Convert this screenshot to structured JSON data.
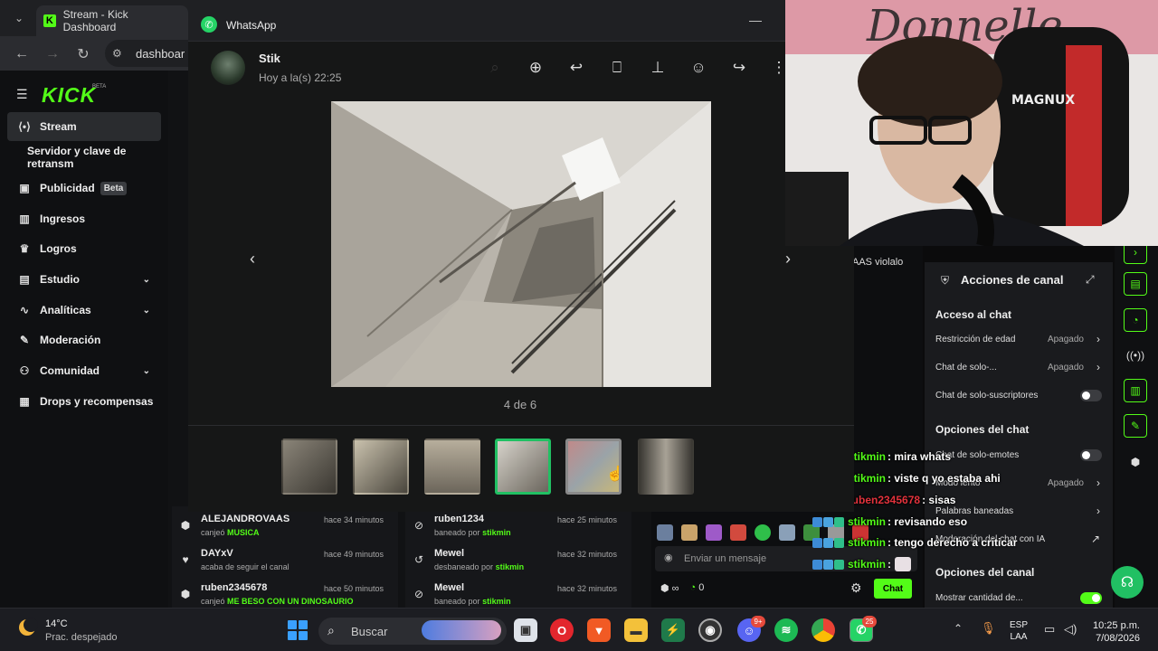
{
  "browser": {
    "tab_title": "Stream - Kick Dashboard",
    "address": "dashboar"
  },
  "kick": {
    "logo": "KICK",
    "logo_beta": "BETA",
    "sidebar": [
      {
        "label": "Stream",
        "icon": "broadcast-icon"
      },
      {
        "label": "Servidor y clave de retransm",
        "icon": ""
      },
      {
        "label": "Publicidad",
        "badge": "Beta",
        "icon": "ad-icon"
      },
      {
        "label": "Ingresos",
        "icon": "revenue-icon"
      },
      {
        "label": "Logros",
        "icon": "trophy-icon"
      },
      {
        "label": "Estudio",
        "icon": "studio-icon"
      },
      {
        "label": "Analíticas",
        "icon": "analytics-icon"
      },
      {
        "label": "Moderación",
        "icon": "wrench-icon"
      },
      {
        "label": "Comunidad",
        "icon": "community-icon"
      },
      {
        "label": "Drops y recompensas",
        "icon": "gift-icon"
      }
    ],
    "feed_left": [
      {
        "name": "ALEJANDROVAAS",
        "action": "canjeó",
        "target": "MUSICA",
        "when": "hace 34 minutos"
      },
      {
        "name": "DAYxV",
        "action": "acaba de seguir el canal",
        "target": "",
        "when": "hace 49 minutos"
      },
      {
        "name": "ruben2345678",
        "action": "canjeó",
        "target": "ME BESO CON UN DINOSAURIO",
        "when": "hace 50 minutos"
      }
    ],
    "feed_right": [
      {
        "name": "ruben1234",
        "action": "baneado por",
        "target": "stikmin",
        "when": "hace 25 minutos"
      },
      {
        "name": "Mewel",
        "action": "desbaneado por",
        "target": "stikmin",
        "when": "hace 32 minutos"
      },
      {
        "name": "Mewel",
        "action": "baneado por",
        "target": "stikmin",
        "when": "hace 32 minutos"
      }
    ],
    "chat": {
      "snippet": "AAS violalo",
      "placeholder": "Enviar un mensaje",
      "points": "0",
      "send_label": "Chat"
    },
    "actions": {
      "title": "Acciones de canal",
      "section_access": "Acceso al chat",
      "age_label": "Restricción de edad",
      "age_value": "Apagado",
      "followers_label": "Chat de solo-...",
      "followers_value": "Apagado",
      "subs_label": "Chat de solo-suscriptores",
      "section_chat": "Opciones del chat",
      "emotes_label": "Chat de solo-emotes",
      "slow_label": "Modo lento",
      "slow_value": "Apagado",
      "banned_words": "Palabras baneadas",
      "ai_mod": "Moderación del chat con IA",
      "section_channel": "Opciones del canal",
      "show_count": "Mostrar cantidad de..."
    }
  },
  "whatsapp": {
    "app_title": "WhatsApp",
    "contact": "Stik",
    "timestamp": "Hoy a la(s) 22:25",
    "counter": "4 de 6",
    "thumbnails": 6,
    "active_thumbnail": 4
  },
  "overlay_chat": [
    {
      "user": "stikmin",
      "color": "#53fc18",
      "text": ": mira whats"
    },
    {
      "user": "stikmin",
      "color": "#53fc18",
      "text": ": viste q yo estaba ahi"
    },
    {
      "user": "ruben2345678",
      "color": "#e2323c",
      "text": ": sisas"
    },
    {
      "user": "stikmin",
      "color": "#53fc18",
      "text": ": revisando eso"
    },
    {
      "user": "stikmin",
      "color": "#53fc18",
      "text": ": tengo derecho a criticar"
    },
    {
      "user": "stikmin",
      "color": "#53fc18",
      "text": ":"
    }
  ],
  "taskbar": {
    "temperature": "14°C",
    "weather": "Prac. despejado",
    "search": "Buscar",
    "discord_badge": "9+",
    "whatsapp_badge": "25",
    "lang_top": "ESP",
    "lang_bottom": "LAA",
    "time": "10:25 p.m.",
    "date": "7/08/2026"
  }
}
